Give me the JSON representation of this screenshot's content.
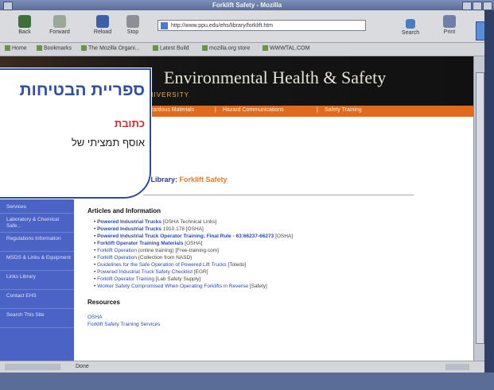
{
  "window": {
    "title": "Forklift Safety - Mozilla"
  },
  "nav": {
    "back": "Back",
    "forward": "Forward",
    "reload": "Reload",
    "stop": "Stop",
    "url": "http://www.ppu.edu/ehs/library/forklift.htm",
    "search": "Search",
    "print": "Print"
  },
  "bookmarks": [
    "Home",
    "Bookmarks",
    "The Mozilla Organi...",
    "Latest Build",
    "mozilla.org store",
    "WWWTAL.COM"
  ],
  "header": {
    "title": "Environmental Health & Safety",
    "subtitle": "UNIVERSITY"
  },
  "topnav": [
    "Hazardous Materials",
    "Hazard Communications",
    "Safety Training"
  ],
  "sidebar": [
    "Services",
    "Laboratory & Chemical Safe...",
    "Regulations Information",
    "MSDS & Links & Equipment",
    "Links Library",
    "Contact EHS",
    "Search This Site"
  ],
  "page": {
    "heading_prefix": "Safety Library:",
    "heading_accent": "Forklift Safety",
    "articles_title": "Articles and Information",
    "articles": [
      {
        "link": "Powered Industrial Trucks",
        "note": "[OSHA Technical Links]"
      },
      {
        "link": "Powered Industrial Trucks",
        "note": "1910.178 [OSHA]"
      },
      {
        "link": "Powered Industrial Truck Operator Training; Final Rule - 63:66237-66273",
        "note": "[OSHA]"
      },
      {
        "link": "Forklift Operator Training Materials",
        "note": "[OSHA]"
      },
      {
        "link": "Forklift Operation",
        "note": "(online training) [Free-training.com]"
      },
      {
        "link": "Forklift Operation",
        "note": "(Collection from NASD)"
      },
      {
        "link": "Guidelines for the Safe Operation of Powered Lift Trucks",
        "note": "[Toledo]"
      },
      {
        "link": "Powered Industrial Truck Safety Checklist",
        "note": "[EGR]"
      },
      {
        "link": "Forklift Operator Training",
        "note": "[Lab Safety Supply]"
      },
      {
        "link": "Worker Safety Compromised When Operating Forklifts in Reverse",
        "note": "[Safety]"
      }
    ],
    "resources_title": "Resources",
    "resources": [
      "OSHA",
      "Forklift Safety Training Services"
    ]
  },
  "status": {
    "text": "Done"
  },
  "callout": {
    "title": "ספריית הבטיחות",
    "subtitle": "כתובת",
    "description": "אוסף תמציתי של"
  }
}
